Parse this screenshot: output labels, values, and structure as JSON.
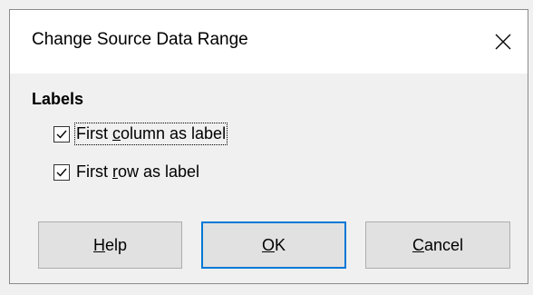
{
  "dialog": {
    "title": "Change Source Data Range",
    "close_icon": "close-icon"
  },
  "labels_section": {
    "heading": "Labels",
    "first_column": {
      "prefix": "First ",
      "mnemonic": "c",
      "suffix": "olumn as label",
      "checked": true
    },
    "first_row": {
      "prefix": "First ",
      "mnemonic": "r",
      "suffix": "ow as label",
      "checked": true
    }
  },
  "buttons": {
    "help": {
      "mnemonic": "H",
      "rest": "elp"
    },
    "ok": {
      "mnemonic": "O",
      "rest": "K"
    },
    "cancel": {
      "mnemonic": "C",
      "rest": "ancel"
    }
  },
  "colors": {
    "accent": "#0078d7",
    "button_face": "#e1e1e1",
    "dialog_background": "#f0f0f0"
  }
}
